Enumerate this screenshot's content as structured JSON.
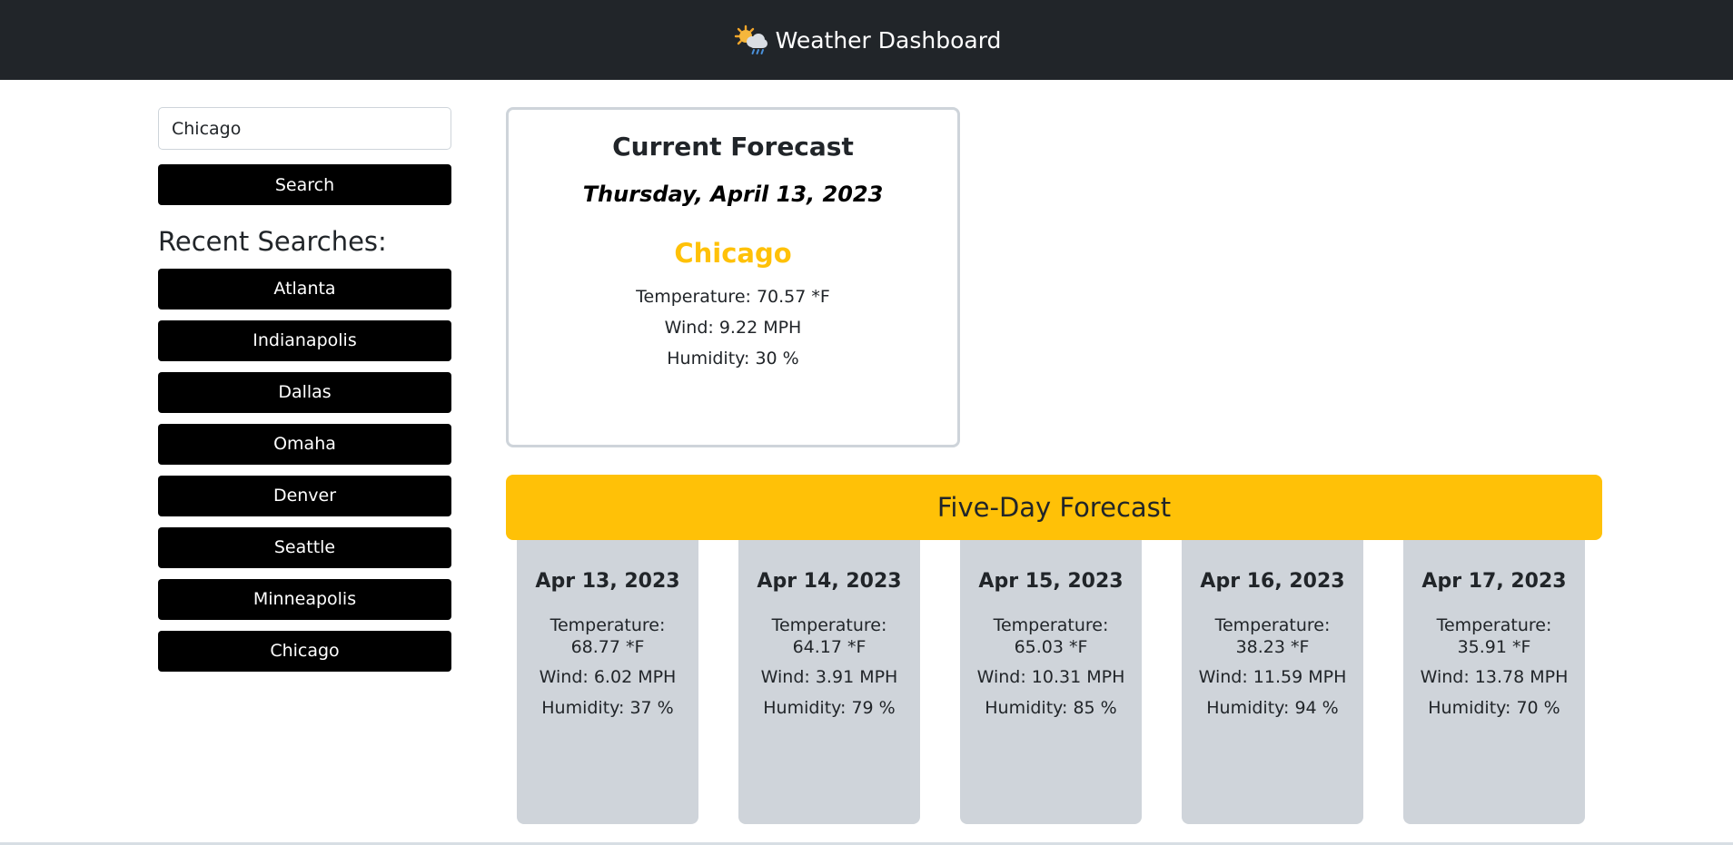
{
  "header": {
    "title": "Weather Dashboard",
    "icon": "sun-behind-rain-cloud-icon"
  },
  "search": {
    "value": "Chicago",
    "button_label": "Search"
  },
  "recent": {
    "title": "Recent Searches:",
    "items": [
      "Atlanta",
      "Indianapolis",
      "Dallas",
      "Omaha",
      "Denver",
      "Seattle",
      "Minneapolis",
      "Chicago"
    ]
  },
  "current": {
    "title": "Current Forecast",
    "date": "Thursday, April 13, 2023",
    "city": "Chicago",
    "temperature": "Temperature: 70.57 *F",
    "wind": "Wind: 9.22 MPH",
    "humidity": "Humidity: 30 %"
  },
  "forecast": {
    "title": "Five-Day Forecast",
    "temperature_label": "Temperature:",
    "days": [
      {
        "date": "Apr 13, 2023",
        "temp": "68.77 *F",
        "wind": "Wind: 6.02 MPH",
        "humidity": "Humidity: 37 %"
      },
      {
        "date": "Apr 14, 2023",
        "temp": "64.17 *F",
        "wind": "Wind: 3.91 MPH",
        "humidity": "Humidity: 79 %"
      },
      {
        "date": "Apr 15, 2023",
        "temp": "65.03 *F",
        "wind": "Wind: 10.31 MPH",
        "humidity": "Humidity: 85 %"
      },
      {
        "date": "Apr 16, 2023",
        "temp": "38.23 *F",
        "wind": "Wind: 11.59 MPH",
        "humidity": "Humidity: 94 %"
      },
      {
        "date": "Apr 17, 2023",
        "temp": "35.91 *F",
        "wind": "Wind: 13.78 MPH",
        "humidity": "Humidity: 70 %"
      }
    ]
  },
  "colors": {
    "navbar": "#212529",
    "accent": "#ffc107",
    "card": "#cfd4da",
    "button": "#000000"
  }
}
